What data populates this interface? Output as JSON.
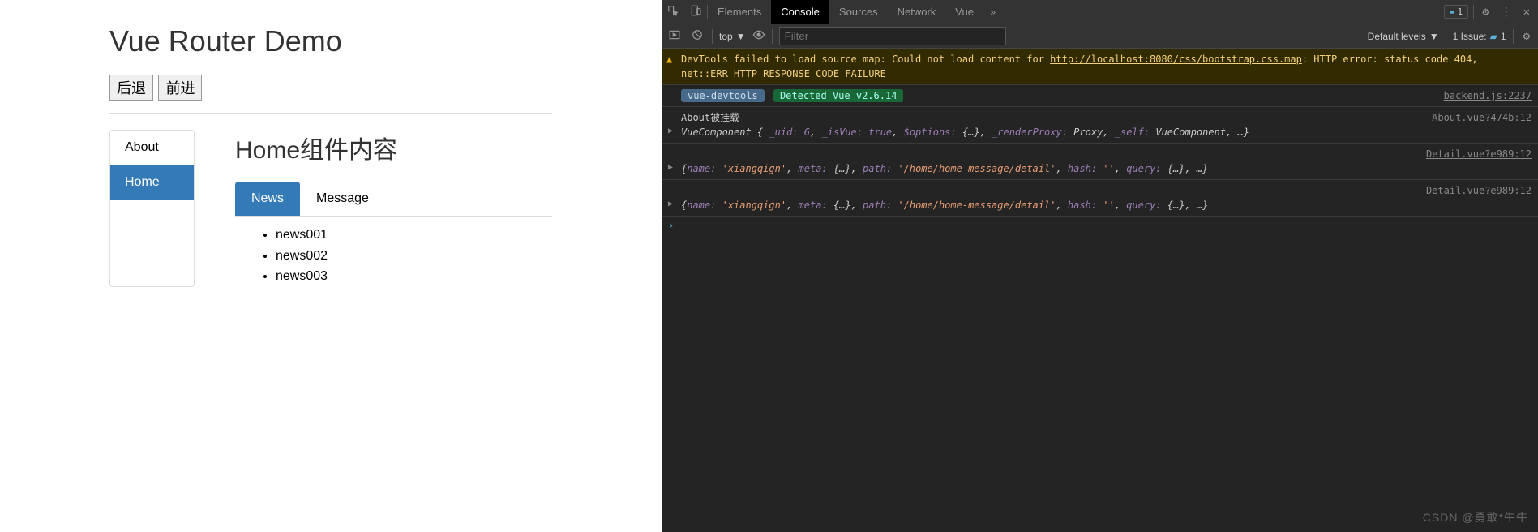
{
  "app": {
    "title": "Vue Router Demo",
    "back_btn": "后退",
    "forward_btn": "前进",
    "sidebar": {
      "items": [
        {
          "label": "About",
          "active": false
        },
        {
          "label": "Home",
          "active": true
        }
      ]
    },
    "content": {
      "heading": "Home组件内容",
      "tabs": [
        {
          "label": "News",
          "active": true
        },
        {
          "label": "Message",
          "active": false
        }
      ],
      "news": [
        "news001",
        "news002",
        "news003"
      ]
    }
  },
  "devtools": {
    "tabs": [
      "Elements",
      "Console",
      "Sources",
      "Network",
      "Vue"
    ],
    "active_tab": "Console",
    "badge_count": "1",
    "toolbar": {
      "context": "top",
      "filter_placeholder": "Filter",
      "levels": "Default levels",
      "issue_label": "1 Issue:",
      "issue_count": "1"
    },
    "messages": {
      "warn": {
        "prefix": "DevTools failed to load source map: Could not load content for ",
        "url": "http://localhost:8080/css/bootstrap.css.map",
        "suffix1": ": HTTP error: status code 404,",
        "suffix2": "net::ERR_HTTP_RESPONSE_CODE_FAILURE"
      },
      "detect": {
        "tag": "vue-devtools",
        "text": "Detected Vue v2.6.14",
        "src": "backend.js:2237"
      },
      "about": {
        "text": "About被挂载",
        "src": "About.vue?474b:12",
        "obj_prefix": "VueComponent {",
        "uid_key": "_uid:",
        "uid_val": "6",
        "isvue_key": "_isVue:",
        "isvue_val": "true",
        "opts_key": "$options:",
        "opts_val": "{…}",
        "rp_key": "_renderProxy:",
        "rp_val": "Proxy",
        "self_key": "_self:",
        "self_val": "VueComponent",
        "tail": ", …}"
      },
      "detail1": {
        "src": "Detail.vue?e989:12",
        "name_key": "name:",
        "name_val": "'xiangqign'",
        "meta_key": "meta:",
        "meta_val": "{…}",
        "path_key": "path:",
        "path_val": "'/home/home-message/detail'",
        "hash_key": "hash:",
        "hash_val": "''",
        "query_key": "query:",
        "query_val": "{…}",
        "tail": ", …}"
      },
      "detail2": {
        "src": "Detail.vue?e989:12",
        "name_key": "name:",
        "name_val": "'xiangqign'",
        "meta_key": "meta:",
        "meta_val": "{…}",
        "path_key": "path:",
        "path_val": "'/home/home-message/detail'",
        "hash_key": "hash:",
        "hash_val": "''",
        "query_key": "query:",
        "query_val": "{…}",
        "tail": ", …}"
      }
    }
  },
  "watermark": "CSDN @勇敢*牛牛"
}
